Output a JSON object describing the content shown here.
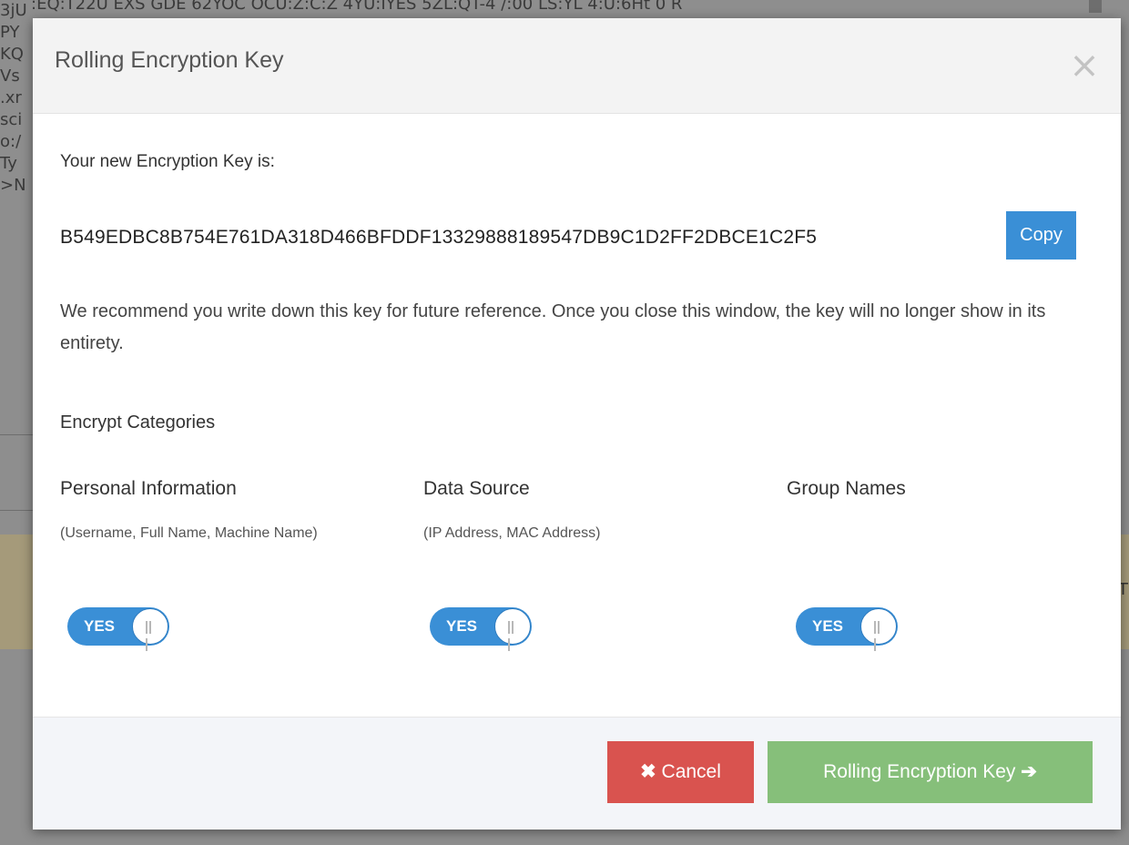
{
  "background": {
    "left_fragments": [
      "3jU",
      "PY",
      "KQ",
      "Vs",
      ".xr",
      "sci",
      "o:/",
      "Ty",
      ">N"
    ],
    "top_line": ":EQ:T22U   EXS  GDE  62YOC   OCU:Z:C:Z   4YU:IYES   5ZL:QT-4  /:00  LS:YL   4:U:6Ht   0   R",
    "right_fragment": "T"
  },
  "modal": {
    "title": "Rolling Encryption Key",
    "close_label": "×",
    "intro": "Your new Encryption Key is:",
    "key": "B549EDBC8B754E761DA318D466BFDDF13329888189547DB9C1D2FF2DBCE1C2F5",
    "copy_label": "Copy",
    "recommendation": "We recommend you write down this key for future reference. Once you close this window, the key will no longer show in its entirety.",
    "section_title": "Encrypt Categories",
    "categories": [
      {
        "title": "Personal Information",
        "description": "(Username, Full Name, Machine Name)",
        "toggle": "YES"
      },
      {
        "title": "Data Source",
        "description": "(IP Address, MAC Address)",
        "toggle": "YES"
      },
      {
        "title": "Group Names",
        "description": "",
        "toggle": "YES"
      }
    ],
    "footer": {
      "cancel_label": "Cancel",
      "cancel_icon": "✖",
      "confirm_label": "Rolling Encryption Key",
      "confirm_icon": "➔"
    }
  },
  "colors": {
    "accent": "#3a8fd6",
    "cancel": "#d9534f",
    "confirm": "#86bf7a"
  }
}
